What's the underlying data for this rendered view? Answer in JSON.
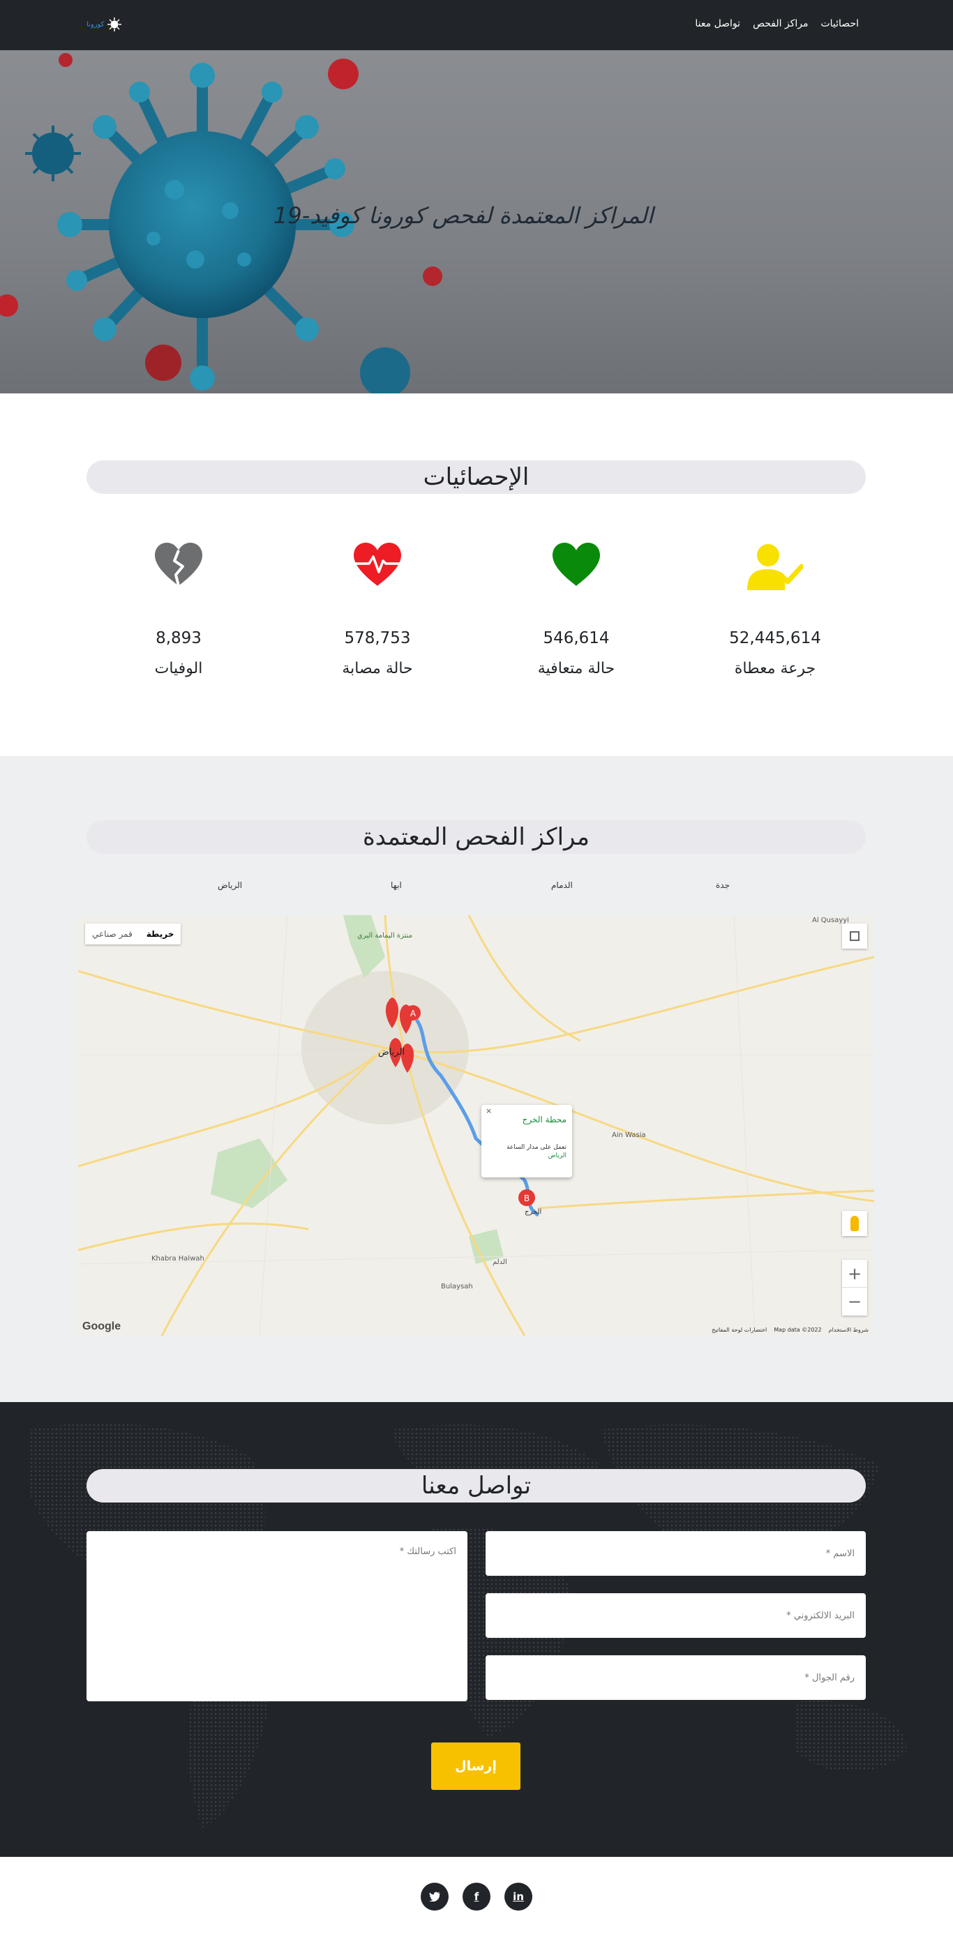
{
  "nav": {
    "brand": "كورونا",
    "links": [
      "احصائيات",
      "مراكز الفحص",
      "تواصل معنا"
    ]
  },
  "hero": {
    "title": "المراكز المعتمدة لفحص كورونا كوفيد-19"
  },
  "stats": {
    "heading": "الإحصائيات",
    "items": [
      {
        "label": "جرعة معطاة",
        "value": "52,445,614",
        "icon": "user-check-icon",
        "color": "#f8e000"
      },
      {
        "label": "حالة متعافية",
        "value": "546,614",
        "icon": "heart-icon",
        "color": "#0a8a0a"
      },
      {
        "label": "حالة مصابة",
        "value": "578,753",
        "icon": "heart-pulse-icon",
        "color": "#ee1c25"
      },
      {
        "label": "الوفيات",
        "value": "8,893",
        "icon": "broken-heart-icon",
        "color": "#6d6e70"
      }
    ]
  },
  "centers": {
    "heading": "مراكز الفحص المعتمدة",
    "cities": [
      "جدة",
      "الدمام",
      "ابها",
      "الرياض"
    ],
    "map": {
      "type_map": "خريطة",
      "type_satellite": "قمر صناعي",
      "info_title": "محطة الخرج",
      "info_hours": "تعمل على مدار الساعة",
      "info_city": "الرياض",
      "footer_terms": "شروط الاستخدام",
      "footer_data": "Map data ©2022",
      "footer_shortcuts": "اختصارات لوحة المفاتيح",
      "google": "Google",
      "places": {
        "riyadh": "الرياض",
        "kharj": "الخرج",
        "ain_wasia": "Ain Wasia",
        "al_qusayyi": "Al Qusayyi",
        "khabra": "Khabra Halwah",
        "bulaysah": "Bulaysah",
        "dilam": "الدلم",
        "yamama": "منتزة اليمامة البري"
      }
    }
  },
  "contact": {
    "heading": "تواصل معنا",
    "name_placeholder": "الاسم *",
    "email_placeholder": "البريد الالكتروني *",
    "phone_placeholder": "رقم الجوال *",
    "message_placeholder": "اكتب رسالتك *",
    "submit": "إرسال"
  },
  "footer": {
    "social": [
      "twitter-icon",
      "facebook-icon",
      "linkedin-icon"
    ]
  }
}
